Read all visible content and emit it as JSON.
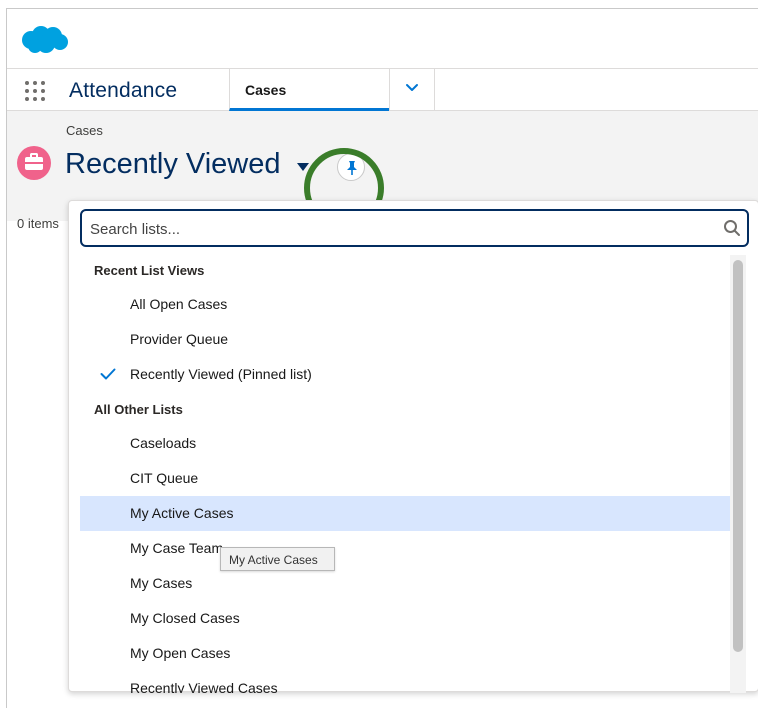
{
  "nav": {
    "app_name": "Attendance",
    "tab_label": "Cases"
  },
  "page_header": {
    "object_label": "Cases",
    "list_title": "Recently Viewed",
    "items_count": "0 items"
  },
  "dropdown": {
    "search_placeholder": "Search lists...",
    "sections": [
      {
        "header": "Recent List Views",
        "items": [
          {
            "label": "All Open Cases"
          },
          {
            "label": "Provider Queue"
          },
          {
            "label": "Recently Viewed (Pinned list)",
            "checked": true
          }
        ]
      },
      {
        "header": "All Other Lists",
        "items": [
          {
            "label": "Caseloads"
          },
          {
            "label": "CIT Queue"
          },
          {
            "label": "My Active Cases",
            "hovered": true
          },
          {
            "label": "My Case Team"
          },
          {
            "label": "My Cases"
          },
          {
            "label": "My Closed Cases"
          },
          {
            "label": "My Open Cases"
          },
          {
            "label": "Recently Viewed Cases"
          }
        ]
      }
    ]
  },
  "tooltip": {
    "text": "My Active Cases"
  },
  "colors": {
    "brand_blue": "#0176d3",
    "title_navy": "#032d60",
    "case_icon_pink": "#f0628b",
    "highlight_green": "#3a7d2a",
    "hover_row": "#d8e6fe"
  },
  "icons": [
    "salesforce-cloud-logo",
    "app-launcher-icon",
    "chevron-down-icon",
    "briefcase-icon",
    "caret-down-icon",
    "pin-icon",
    "search-icon",
    "check-icon"
  ]
}
